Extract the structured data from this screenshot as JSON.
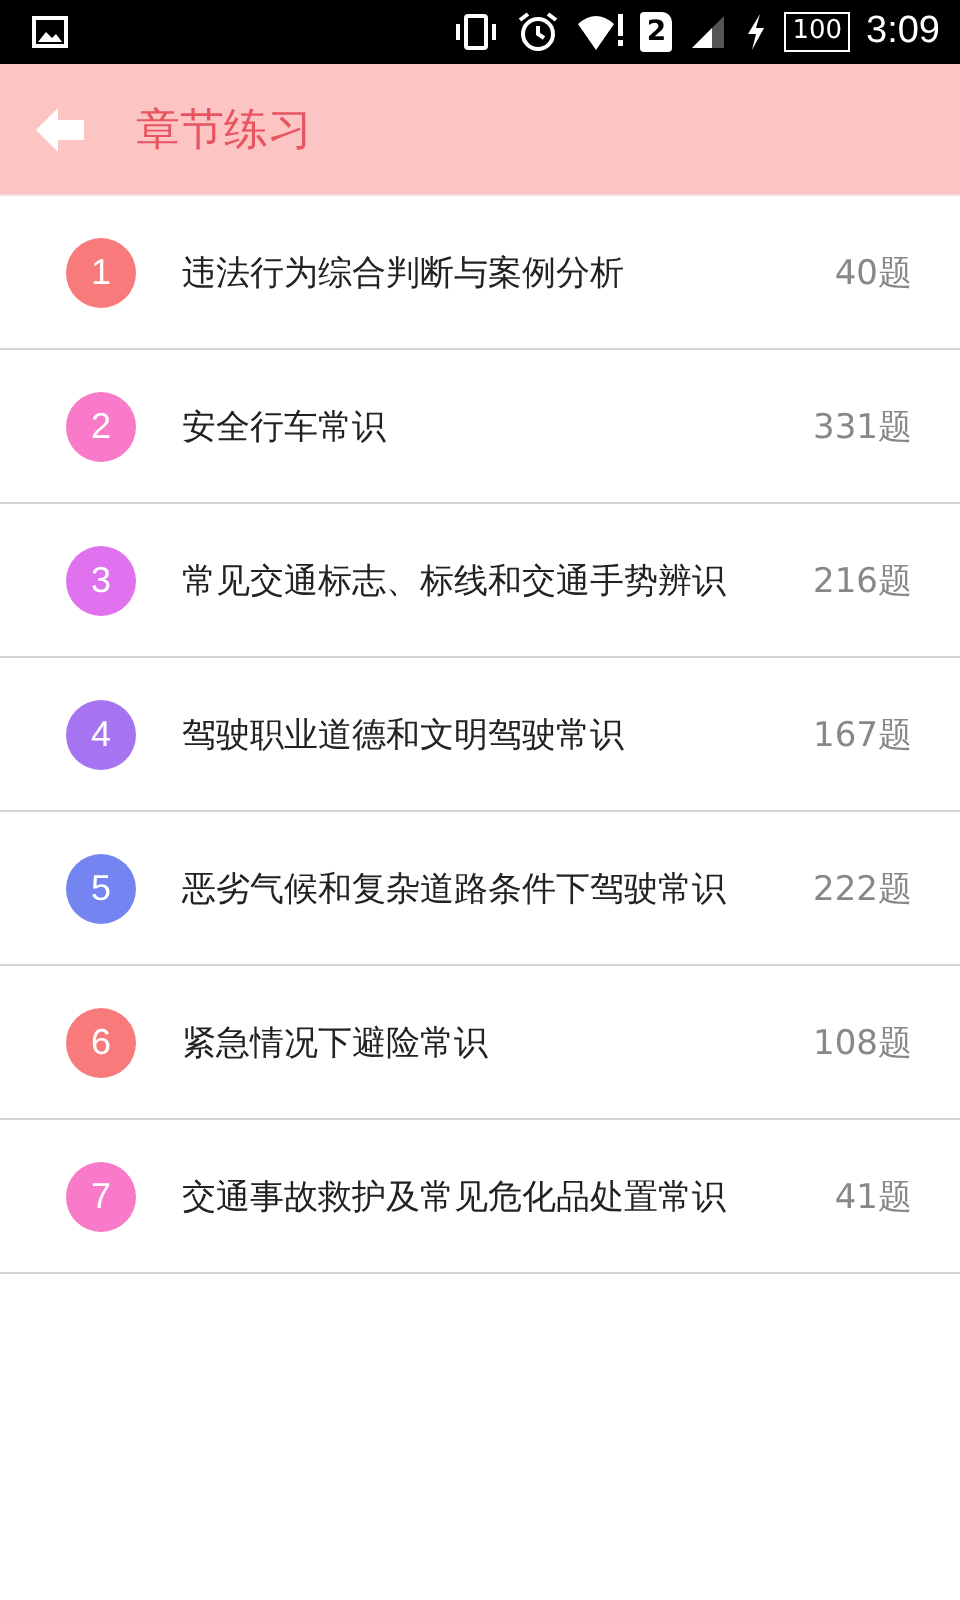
{
  "status_bar": {
    "sim_slot": "2",
    "battery": "100",
    "time": "3:09"
  },
  "header": {
    "title": "章节练习"
  },
  "chapters": [
    {
      "number": "1",
      "title": "违法行为综合判断与案例分析",
      "count": "40题",
      "color": "#f87a7a"
    },
    {
      "number": "2",
      "title": "安全行车常识",
      "count": "331题",
      "color": "#f87ac8"
    },
    {
      "number": "3",
      "title": "常见交通标志、标线和交通手势辨识",
      "count": "216题",
      "color": "#e072f0"
    },
    {
      "number": "4",
      "title": "驾驶职业道德和文明驾驶常识",
      "count": "167题",
      "color": "#a674f0"
    },
    {
      "number": "5",
      "title": "恶劣气候和复杂道路条件下驾驶常识",
      "count": "222题",
      "color": "#7484f0"
    },
    {
      "number": "6",
      "title": "紧急情况下避险常识",
      "count": "108题",
      "color": "#f87a7a"
    },
    {
      "number": "7",
      "title": "交通事故救护及常见危化品处置常识",
      "count": "41题",
      "color": "#f87ac8"
    }
  ]
}
